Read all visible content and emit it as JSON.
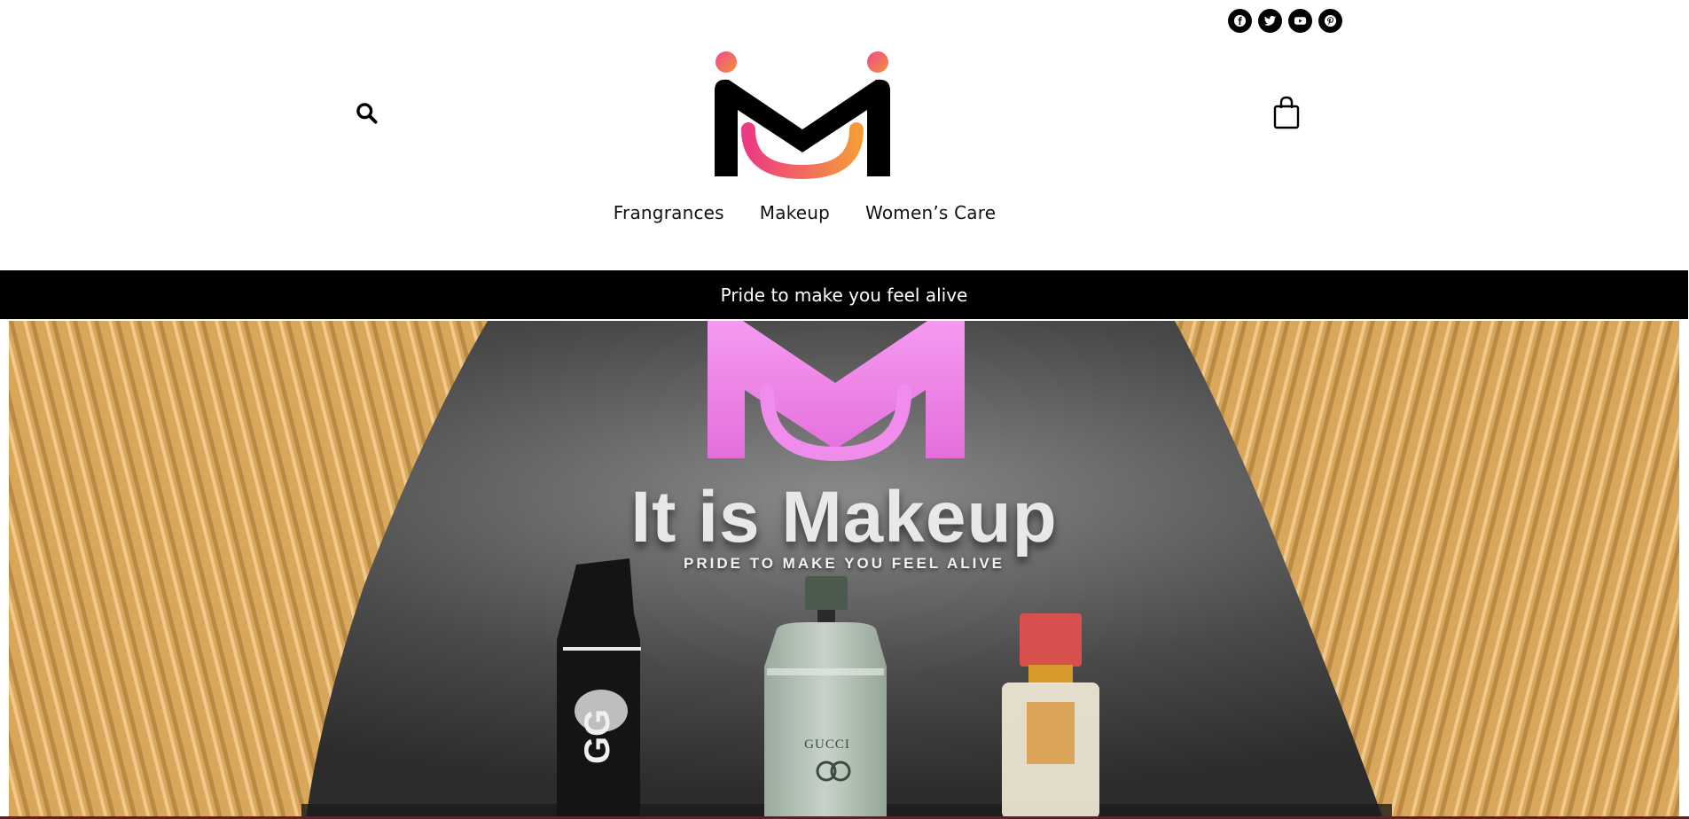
{
  "header": {
    "logo_label": "logo",
    "social": [
      {
        "name": "facebook-icon"
      },
      {
        "name": "twitter-icon"
      },
      {
        "name": "youtube-icon"
      },
      {
        "name": "pinterest-icon"
      }
    ],
    "search_icon": "search-icon",
    "cart_icon": "shopping-bag-icon"
  },
  "nav": {
    "items": [
      "Frangrances",
      "Makeup",
      "Women’s Care"
    ]
  },
  "banner": {
    "text": "Pride to make you feel alive"
  },
  "hero": {
    "title": "It is Makeup",
    "tagline": "PRIDE TO MAKE YOU FEEL ALIVE",
    "bottle_brand_label": "GUCCI",
    "spray_label": "GG"
  },
  "colors": {
    "brand_pink": "#ee6fe6",
    "gradient_start": "#ec3b82",
    "gradient_end": "#f59a3a",
    "banner_bg": "#000000",
    "curtain": "#d6a45a"
  }
}
